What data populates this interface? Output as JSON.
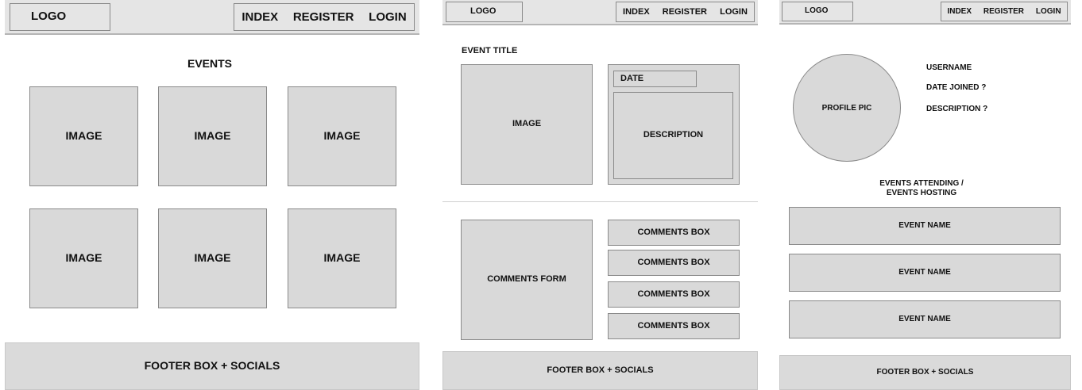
{
  "panel1": {
    "logo": "LOGO",
    "nav": [
      "INDEX",
      "REGISTER",
      "LOGIN"
    ],
    "heading": "EVENTS",
    "images": [
      "IMAGE",
      "IMAGE",
      "IMAGE",
      "IMAGE",
      "IMAGE",
      "IMAGE"
    ],
    "footer": "FOOTER BOX + SOCIALS"
  },
  "panel2": {
    "logo": "LOGO",
    "nav": [
      "INDEX",
      "REGISTER",
      "LOGIN"
    ],
    "event_title": "EVENT TITLE",
    "image": "IMAGE",
    "date": "DATE",
    "description": "DESCRIPTION",
    "comments_form": "COMMENTS FORM",
    "comments": [
      "COMMENTS BOX",
      "COMMENTS BOX",
      "COMMENTS BOX",
      "COMMENTS BOX"
    ],
    "footer": "FOOTER BOX + SOCIALS"
  },
  "panel3": {
    "logo": "LOGO",
    "nav": [
      "INDEX",
      "REGISTER",
      "LOGIN"
    ],
    "profile_pic": "PROFILE PIC",
    "username": "USERNAME",
    "date_joined": "DATE JOINED ?",
    "description": "DESCRIPTION ?",
    "events_heading_line1": "EVENTS ATTENDING /",
    "events_heading_line2": "EVENTS HOSTING",
    "events": [
      "EVENT NAME",
      "EVENT NAME",
      "EVENT NAME"
    ],
    "footer": "FOOTER BOX + SOCIALS"
  }
}
